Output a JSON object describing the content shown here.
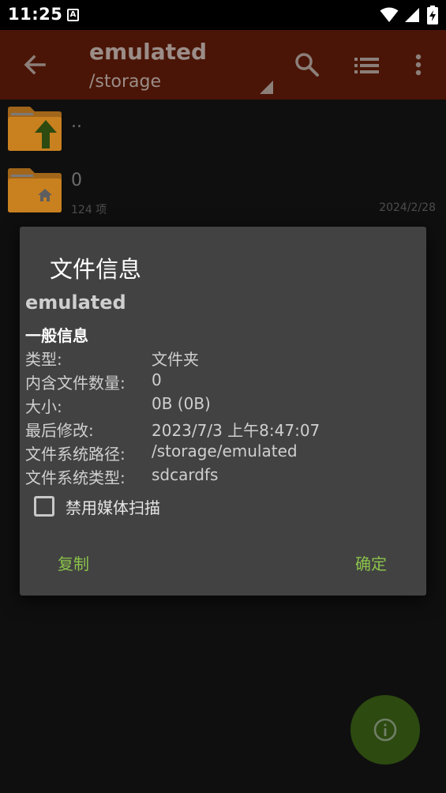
{
  "status_bar": {
    "time": "11:25",
    "notification_letter": "A"
  },
  "app_bar": {
    "title": "emulated",
    "subtitle": "/storage",
    "icons": [
      "back-arrow-icon",
      "search-icon",
      "list-view-icon",
      "more-vert-icon"
    ]
  },
  "file_list": {
    "items": [
      {
        "name": "..",
        "meta": "",
        "date": "",
        "icon": "folder-up-icon"
      },
      {
        "name": "0",
        "meta": "124 项",
        "date": "2024/2/28",
        "icon": "folder-home-icon"
      }
    ]
  },
  "dialog": {
    "title": "文件信息",
    "file_name": "emulated",
    "section_title": "一般信息",
    "rows": [
      {
        "label": "类型:",
        "value": "文件夹"
      },
      {
        "label": "内含文件数量:",
        "value": "0"
      },
      {
        "label": "大小:",
        "value": "0B (0B)"
      },
      {
        "label": "最后修改:",
        "value": "2023/7/3 上午8:47:07"
      },
      {
        "label": "文件系统路径:",
        "value": "/storage/emulated"
      },
      {
        "label": "文件系统类型:",
        "value": "sdcardfs"
      }
    ],
    "checkbox": {
      "label": "禁用媒体扫描",
      "checked": false
    },
    "buttons": {
      "copy": "复制",
      "ok": "确定"
    }
  },
  "colors": {
    "app_bar": "#4a1506",
    "accent": "#8bc34a",
    "folder": "#c9801f",
    "dialog_bg": "#424242",
    "fab": "#2d4a10"
  }
}
